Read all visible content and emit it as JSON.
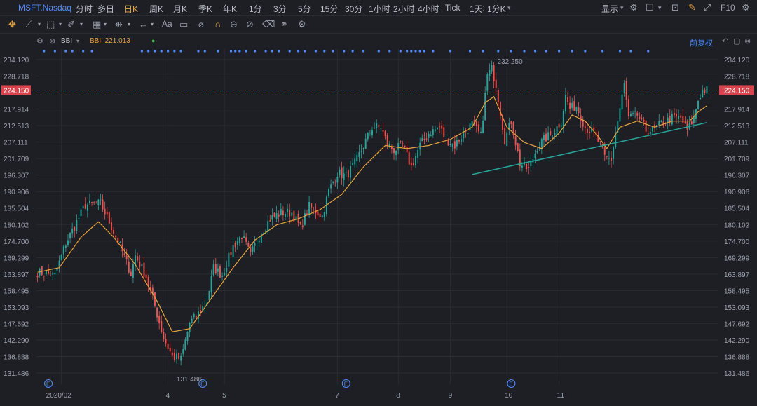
{
  "header": {
    "symbol": "MSFT.Nasdaq",
    "periods": [
      "分时",
      "多日",
      "日K",
      "周K",
      "月K",
      "季K",
      "年K",
      "1分",
      "3分",
      "5分",
      "15分",
      "30分",
      "1小时",
      "2小时",
      "4小时",
      "Tick",
      "1天",
      "1分K"
    ],
    "active_period": "日K",
    "display_label": "显示",
    "f10_label": "F10"
  },
  "indicator": {
    "name": "BBI",
    "label": "BBI: 221.013",
    "adjust_label": "前复权"
  },
  "colors": {
    "up": "#26a69a",
    "down": "#ef5350",
    "bbi": "#e6a23c",
    "trendline": "#26a69a",
    "last_price_bg": "#d9434d",
    "dots": "#4f8bff"
  },
  "chart_data": {
    "type": "candlestick",
    "title": "",
    "ylim": [
      131.486,
      234.12
    ],
    "y_ticks": [
      "234.120",
      "228.718",
      "224.150",
      "217.914",
      "212.513",
      "207.111",
      "201.709",
      "196.307",
      "190.906",
      "185.504",
      "180.102",
      "174.700",
      "169.299",
      "163.897",
      "158.495",
      "153.093",
      "147.692",
      "142.290",
      "136.888",
      "131.486"
    ],
    "last_price": "224.150",
    "x_labels": [
      "2020/02",
      "4",
      "5",
      "7",
      "8",
      "9",
      "10",
      "11"
    ],
    "high_annotation": "232.250",
    "low_annotation": "131.486",
    "earnings_marker": "E",
    "anchors": [
      [
        0,
        164.5
      ],
      [
        8,
        163.5
      ],
      [
        13,
        174
      ],
      [
        22,
        186.5
      ],
      [
        29,
        187
      ],
      [
        33,
        181
      ],
      [
        38,
        173
      ],
      [
        43,
        164
      ],
      [
        45,
        170
      ],
      [
        50,
        163
      ],
      [
        53,
        156
      ],
      [
        58,
        143
      ],
      [
        62,
        137
      ],
      [
        66,
        136
      ],
      [
        70,
        148
      ],
      [
        73,
        150
      ],
      [
        78,
        155
      ],
      [
        81,
        166
      ],
      [
        85,
        163.5
      ],
      [
        90,
        173
      ],
      [
        94,
        176.5
      ],
      [
        98,
        170
      ],
      [
        102,
        176.5
      ],
      [
        107,
        182
      ],
      [
        112,
        184
      ],
      [
        117,
        184
      ],
      [
        121,
        179
      ],
      [
        125,
        186
      ],
      [
        131,
        183
      ],
      [
        134,
        191
      ],
      [
        138,
        197
      ],
      [
        142,
        196
      ],
      [
        146,
        200
      ],
      [
        150,
        206
      ],
      [
        154,
        212
      ],
      [
        158,
        212
      ],
      [
        161,
        206.5
      ],
      [
        164,
        204.5
      ],
      [
        168,
        206
      ],
      [
        172,
        199
      ],
      [
        176,
        206
      ],
      [
        180,
        210
      ],
      [
        185,
        212
      ],
      [
        188,
        208
      ],
      [
        192,
        206
      ],
      [
        196,
        210
      ],
      [
        200,
        213
      ],
      [
        204,
        209
      ],
      [
        207,
        229
      ],
      [
        209,
        231
      ],
      [
        211,
        226
      ],
      [
        215,
        208
      ],
      [
        218,
        214
      ],
      [
        222,
        200
      ],
      [
        226,
        198
      ],
      [
        230,
        205.5
      ],
      [
        233,
        208
      ],
      [
        237,
        210
      ],
      [
        241,
        214
      ],
      [
        243,
        222
      ],
      [
        245,
        218
      ],
      [
        248,
        219
      ],
      [
        252,
        212
      ],
      [
        256,
        210
      ],
      [
        259,
        206
      ],
      [
        261,
        202
      ],
      [
        264,
        201.5
      ],
      [
        267,
        214
      ],
      [
        270,
        226
      ],
      [
        272,
        215
      ],
      [
        276,
        216
      ],
      [
        280,
        211
      ],
      [
        283,
        211
      ],
      [
        287,
        213
      ],
      [
        292,
        215
      ],
      [
        296,
        215
      ],
      [
        299,
        211
      ],
      [
        302,
        215
      ],
      [
        304,
        221
      ],
      [
        306,
        224
      ],
      [
        308,
        224.15
      ]
    ],
    "bbi_anchors": [
      [
        0,
        164.5
      ],
      [
        10,
        166
      ],
      [
        20,
        176
      ],
      [
        28,
        181
      ],
      [
        35,
        176
      ],
      [
        45,
        167
      ],
      [
        55,
        155
      ],
      [
        62,
        145
      ],
      [
        70,
        146
      ],
      [
        80,
        156
      ],
      [
        90,
        166
      ],
      [
        100,
        175
      ],
      [
        110,
        180
      ],
      [
        120,
        182
      ],
      [
        130,
        185
      ],
      [
        140,
        190
      ],
      [
        150,
        199
      ],
      [
        160,
        206
      ],
      [
        170,
        205
      ],
      [
        180,
        206
      ],
      [
        190,
        208
      ],
      [
        200,
        212
      ],
      [
        206,
        220
      ],
      [
        210,
        222
      ],
      [
        216,
        212
      ],
      [
        224,
        207
      ],
      [
        232,
        205
      ],
      [
        240,
        210
      ],
      [
        246,
        216
      ],
      [
        252,
        214
      ],
      [
        258,
        209
      ],
      [
        262,
        205
      ],
      [
        268,
        212
      ],
      [
        276,
        214
      ],
      [
        284,
        212
      ],
      [
        292,
        214
      ],
      [
        300,
        214
      ],
      [
        304,
        217
      ],
      [
        308,
        219
      ]
    ],
    "trendline": [
      [
        200,
        196.5
      ],
      [
        308,
        213.5
      ]
    ],
    "candle_count": 309
  }
}
